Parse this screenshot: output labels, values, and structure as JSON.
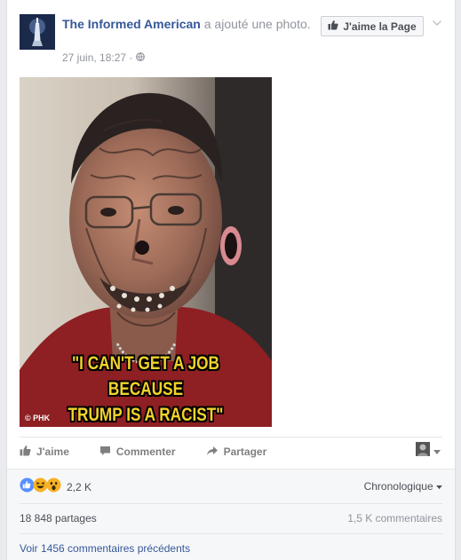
{
  "post": {
    "page_name": "The Informed American",
    "action_text": " a ajouté une photo.",
    "timestamp": "27 juin, 18:27 ·",
    "privacy_icon": "globe-icon",
    "like_page_label": "J'aime la Page"
  },
  "photo": {
    "caption_line1": "\"I CAN'T GET A JOB BECAUSE",
    "caption_line2": "TRUMP IS A RACIST\"",
    "watermark": "© PHK"
  },
  "actions": {
    "like": "J'aime",
    "comment": "Commenter",
    "share": "Partager"
  },
  "reactions": {
    "icons": [
      "like-reaction-icon",
      "haha-reaction-icon",
      "wow-reaction-icon"
    ],
    "count": "2,2 K",
    "sort_label": "Chronologique"
  },
  "stats": {
    "shares": "18 848 partages",
    "comments": "1,5 K commentaires"
  },
  "comments": {
    "more_link": "Voir 1456 commentaires précédents"
  },
  "colors": {
    "link": "#365899",
    "caption": "#f0d22a",
    "like_blue": "#5890ff"
  }
}
